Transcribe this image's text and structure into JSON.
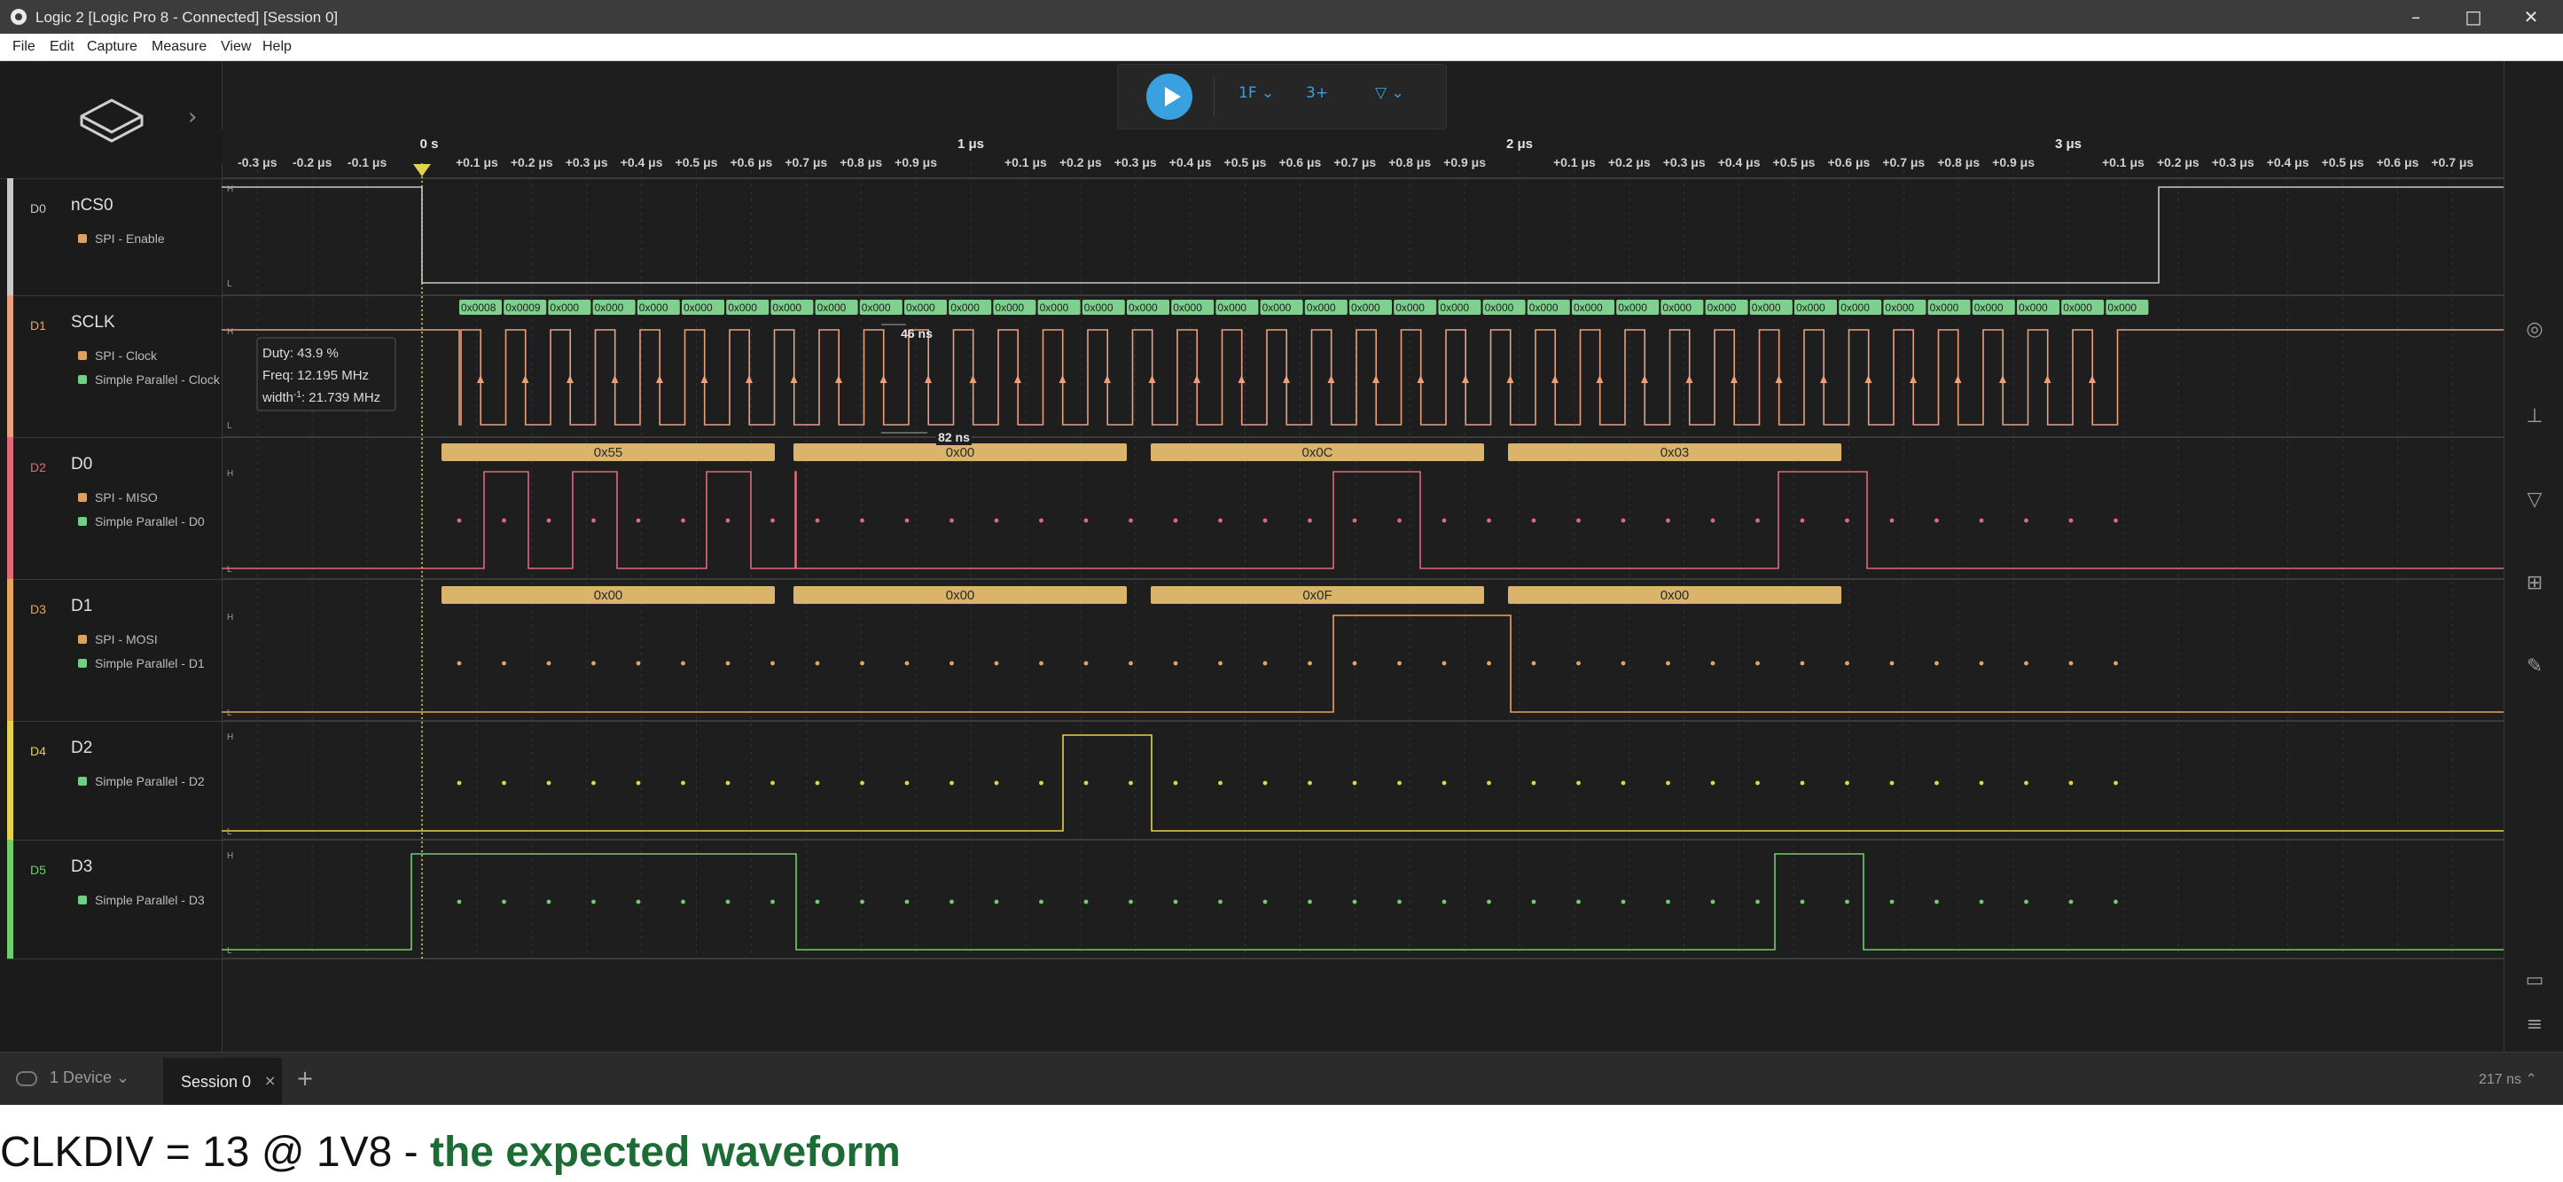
{
  "window": {
    "title": "Logic 2 [Logic Pro 8 - Connected] [Session 0]",
    "minimize": "–",
    "maximize": "□",
    "close": "✕"
  },
  "menu": [
    "File",
    "Edit",
    "Capture",
    "Measure",
    "View",
    "Help"
  ],
  "toolbar": {
    "play": "play-icon",
    "trigger_icon": "1F",
    "measure_icon": "3+",
    "marker_icon": "marker"
  },
  "time_axis": {
    "major": [
      "0 s",
      "1 μs",
      "2 μs",
      "3 μs"
    ],
    "minor_before_zero": [
      "μs",
      "-0.3 μs",
      "-0.2 μs",
      "-0.1 μs"
    ],
    "minor": [
      "+0.1 μs",
      "+0.2 μs",
      "+0.3 μs",
      "+0.4 μs",
      "+0.5 μs",
      "+0.6 μs",
      "+0.7 μs",
      "+0.8 μs",
      "+0.9 μs"
    ],
    "trigger_label": "T"
  },
  "channels": [
    {
      "id": "D0",
      "name": "nCS0",
      "color": "#c8c8c8",
      "analyzers": [
        {
          "label": "SPI - Enable",
          "color": "#e0a060"
        }
      ]
    },
    {
      "id": "D1",
      "name": "SCLK",
      "color": "#e8a07e",
      "analyzers": [
        {
          "label": "SPI - Clock",
          "color": "#e0a060"
        },
        {
          "label": "Simple Parallel - Clock",
          "color": "#6fcf85"
        }
      ]
    },
    {
      "id": "D2",
      "name": "D0",
      "color": "#e06a7a",
      "analyzers": [
        {
          "label": "SPI - MISO",
          "color": "#e0a060"
        },
        {
          "label": "Simple Parallel - D0",
          "color": "#6fcf85"
        }
      ]
    },
    {
      "id": "D3",
      "name": "D1",
      "color": "#e8a55a",
      "analyzers": [
        {
          "label": "SPI - MOSI",
          "color": "#e0a060"
        },
        {
          "label": "Simple Parallel - D1",
          "color": "#6fcf85"
        }
      ]
    },
    {
      "id": "D4",
      "name": "D2",
      "color": "#e3d24e",
      "analyzers": [
        {
          "label": "Simple Parallel - D2",
          "color": "#6fcf85"
        }
      ]
    },
    {
      "id": "D5",
      "name": "D3",
      "color": "#6fcf6a",
      "analyzers": [
        {
          "label": "Simple Parallel - D3",
          "color": "#6fcf85"
        }
      ]
    }
  ],
  "level_labels": {
    "high": "H",
    "low": "L"
  },
  "measurement": {
    "duty": "Duty: 43.9 %",
    "freq": "Freq: 12.195 MHz",
    "width": "width",
    "width_sup": "-1",
    "width_value": ": 21.739 MHz"
  },
  "timing_annotations": {
    "high_width": "46 ns",
    "period": "82 ns"
  },
  "parallel_values": [
    "0x0008",
    "0x0009",
    "0x000",
    "0x000",
    "0x000",
    "0x000",
    "0x000",
    "0x000",
    "0x000",
    "0x000",
    "0x000",
    "0x000",
    "0x000",
    "0x000",
    "0x000",
    "0x000",
    "0x000",
    "0x000",
    "0x000",
    "0x000",
    "0x000",
    "0x000",
    "0x000",
    "0x000",
    "0x000",
    "0x000",
    "0x000",
    "0x000",
    "0x000",
    "0x000",
    "0x000",
    "0x000",
    "0x000",
    "0x000",
    "0x000",
    "0x000",
    "0x000",
    "0x000",
    "0x000"
  ],
  "miso_bytes": [
    "0x55",
    "0x00",
    "0x0C",
    "0x03"
  ],
  "mosi_bytes": [
    "0x00",
    "0x00",
    "0x0F",
    "0x00"
  ],
  "tabs": {
    "device": "1 Device",
    "session": "Session 0",
    "close": "×",
    "add": "+"
  },
  "status": "217 ns ⌃",
  "caption": {
    "plain": "CLKDIV = 13 @ 1V8 - ",
    "bold": "the expected waveform"
  },
  "colors": {
    "bg": "#1e1e1e",
    "accent": "#3aa1e0",
    "spi_bubble": "#d9b46a",
    "parallel_bubble": "#7fd08e"
  }
}
